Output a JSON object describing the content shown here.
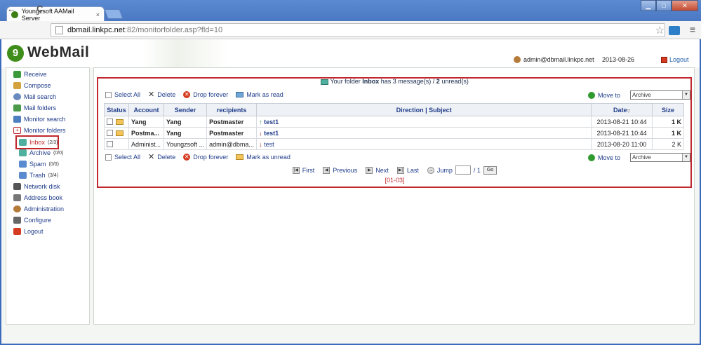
{
  "browser": {
    "tab_title": "Youngzsoft AAMail Server",
    "tab_close": "×",
    "url_host": "dbmail.linkpc.net",
    "url_rest": ":82/monitorfolder.asp?fld=10",
    "win_min": "▁",
    "win_max": "□",
    "win_close": "✕",
    "back": "←",
    "forward": "→",
    "reload": "C",
    "star": "☆",
    "menu": "≡"
  },
  "header": {
    "logo_letter": "9",
    "logo_text": "WebMail",
    "user": "admin@dbmail.linkpc.net",
    "date": "2013-08-26",
    "logout": "Logout"
  },
  "sidebar": {
    "items": [
      {
        "label": "Receive",
        "icon": "receive-icon",
        "color": "#3a9a3a"
      },
      {
        "label": "Compose",
        "icon": "compose-icon",
        "color": "#d4a23a"
      },
      {
        "label": "Mail search",
        "icon": "mail-search-icon",
        "color": "#6a8abf"
      },
      {
        "label": "Mail folders",
        "icon": "mail-folders-icon",
        "color": "#4a9a4a"
      },
      {
        "label": "Monitor search",
        "icon": "monitor-search-icon",
        "color": "#4f7fc0"
      },
      {
        "label": "Monitor folders",
        "icon": "monitor-folders-icon",
        "color": "#c0282d"
      }
    ],
    "subfolders": [
      {
        "label": "Inbox",
        "count": "(2/3)",
        "icon": "inbox-folder-icon"
      },
      {
        "label": "Archive",
        "count": "(0/0)",
        "icon": "archive-folder-icon"
      },
      {
        "label": "Spam",
        "count": "(0/0)",
        "icon": "spam-folder-icon"
      },
      {
        "label": "Trash",
        "count": "(3/4)",
        "icon": "trash-folder-icon"
      }
    ],
    "tools": [
      {
        "label": "Network disk",
        "icon": "network-disk-icon",
        "color": "#555"
      },
      {
        "label": "Address book",
        "icon": "address-book-icon",
        "color": "#777"
      },
      {
        "label": "Administration",
        "icon": "administration-icon",
        "color": "#b47b3a"
      },
      {
        "label": "Configure",
        "icon": "configure-icon",
        "color": "#666"
      },
      {
        "label": "Logout",
        "icon": "logout-icon",
        "color": "#d43b20"
      }
    ]
  },
  "folder_info": {
    "prefix": "Your folder",
    "folder": "Inbox",
    "middle": "has 3 message(s) /",
    "unread": "2",
    "suffix": "unread(s)"
  },
  "actions_top": {
    "select_all": "Select All",
    "delete": "Delete",
    "drop_forever": "Drop forever",
    "mark": "Mark as read",
    "move_to": "Move to",
    "target": "Archive"
  },
  "actions_bottom": {
    "select_all": "Select All",
    "delete": "Delete",
    "drop_forever": "Drop forever",
    "mark": "Mark as unread",
    "move_to": "Move to",
    "target": "Archive"
  },
  "table": {
    "headers": {
      "status": "Status",
      "account": "Account",
      "sender": "Sender",
      "recipients": "recipients",
      "subject": "Direction | Subject",
      "date": "Date",
      "size": "Size"
    },
    "rows": [
      {
        "account": "Yang",
        "sender": "Yang",
        "recipients": "Postmaster",
        "direction": "↑",
        "subject": "test1",
        "date": "2013-08-21 10:44",
        "size": "1 K",
        "unread": true
      },
      {
        "account": "Postma...",
        "sender": "Yang",
        "recipients": "Postmaster",
        "direction": "↓",
        "subject": "test1",
        "date": "2013-08-21 10:44",
        "size": "1 K",
        "unread": true
      },
      {
        "account": "Administ...",
        "sender": "Youngzsoft ...",
        "recipients": "admin@dbma...",
        "direction": "↓",
        "subject": "test",
        "date": "2013-08-20 11:00",
        "size": "2 K",
        "unread": false
      }
    ]
  },
  "pager": {
    "first": "First",
    "previous": "Previous",
    "next": "Next",
    "last": "Last",
    "jump": "Jump",
    "total": "/ 1",
    "go": "Go",
    "range": "[01-03]"
  }
}
